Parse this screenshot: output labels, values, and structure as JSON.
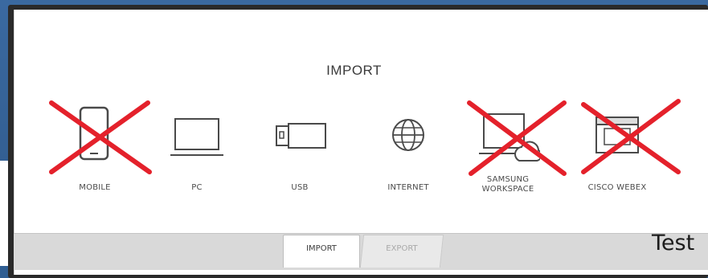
{
  "dialog": {
    "title": "IMPORT"
  },
  "sources": [
    {
      "label": "MOBILE",
      "icon": "mobile-phone-icon",
      "crossed_out": true
    },
    {
      "label": "PC",
      "icon": "laptop-icon",
      "crossed_out": false
    },
    {
      "label": "USB",
      "icon": "usb-drive-icon",
      "crossed_out": false
    },
    {
      "label": "INTERNET",
      "icon": "globe-icon",
      "crossed_out": false
    },
    {
      "label": "SAMSUNG\nWORKSPACE",
      "icon": "laptop-cloud-icon",
      "crossed_out": true
    },
    {
      "label": "CISCO WEBEX",
      "icon": "webex-monitor-icon",
      "crossed_out": true
    }
  ],
  "tabs": {
    "import": "IMPORT",
    "export": "EXPORT",
    "active": "import"
  },
  "overlay_text": "Test",
  "colors": {
    "background_blue": "#335f93",
    "cross_red": "#e4212b",
    "icon_stroke": "#4a4a4a",
    "tabbar_gray": "#d9d9d9"
  }
}
